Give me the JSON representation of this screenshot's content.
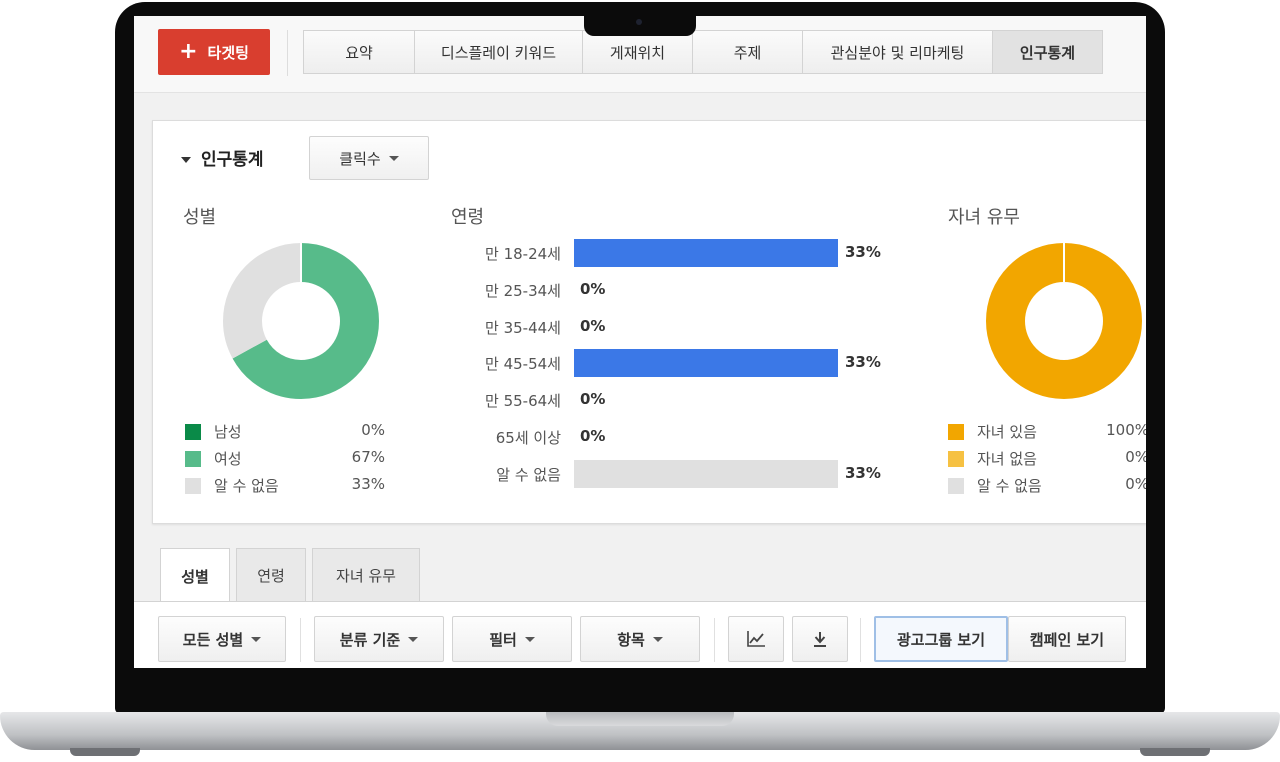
{
  "header": {
    "target_button": "타겟팅",
    "tabs": [
      "요약",
      "디스플레이 키워드",
      "게재위치",
      "주제",
      "관심분야 및 리마케팅",
      "인구통계"
    ],
    "active_tab": "인구통계"
  },
  "panel": {
    "title": "인구통계",
    "metric_dropdown": "클릭수"
  },
  "gender": {
    "title": "성별",
    "items": [
      {
        "label": "남성",
        "value": "0%",
        "fraction": 0,
        "color": "#0a8a48"
      },
      {
        "label": "여성",
        "value": "67%",
        "fraction": 0.67,
        "color": "#57bb8a"
      },
      {
        "label": "알 수 없음",
        "value": "33%",
        "fraction": 0.33,
        "color": "#e0e0e0"
      }
    ]
  },
  "age": {
    "title": "연령",
    "rows": [
      {
        "label": "만 18-24세",
        "value": "33%",
        "fraction": 0.33,
        "color": "#3b78e7"
      },
      {
        "label": "만 25-34세",
        "value": "0%",
        "fraction": 0,
        "color": "#3b78e7"
      },
      {
        "label": "만 35-44세",
        "value": "0%",
        "fraction": 0,
        "color": "#3b78e7"
      },
      {
        "label": "만 45-54세",
        "value": "33%",
        "fraction": 0.33,
        "color": "#3b78e7"
      },
      {
        "label": "만 55-64세",
        "value": "0%",
        "fraction": 0,
        "color": "#3b78e7"
      },
      {
        "label": "65세 이상",
        "value": "0%",
        "fraction": 0,
        "color": "#3b78e7"
      },
      {
        "label": "알 수 없음",
        "value": "33%",
        "fraction": 0.33,
        "color": "#e0e0e0"
      }
    ]
  },
  "parental": {
    "title": "자녀 유무",
    "items": [
      {
        "label": "자녀 있음",
        "value": "100%",
        "fraction": 1,
        "color": "#f2a600"
      },
      {
        "label": "자녀 없음",
        "value": "0%",
        "fraction": 0,
        "color": "#f6c142"
      },
      {
        "label": "알 수 없음",
        "value": "0%",
        "fraction": 0,
        "color": "#e0e0e0"
      }
    ]
  },
  "bottom_tabs": [
    "성별",
    "연령",
    "자녀 유무"
  ],
  "toolbar": {
    "gender_filter": "모든 성별",
    "segment": "분류 기준",
    "filter": "필터",
    "columns": "항목",
    "chart_icon": "line-chart-icon",
    "download_icon": "download-icon",
    "adgroup_view": "광고그룹 보기",
    "campaign_view": "캠페인 보기"
  }
}
